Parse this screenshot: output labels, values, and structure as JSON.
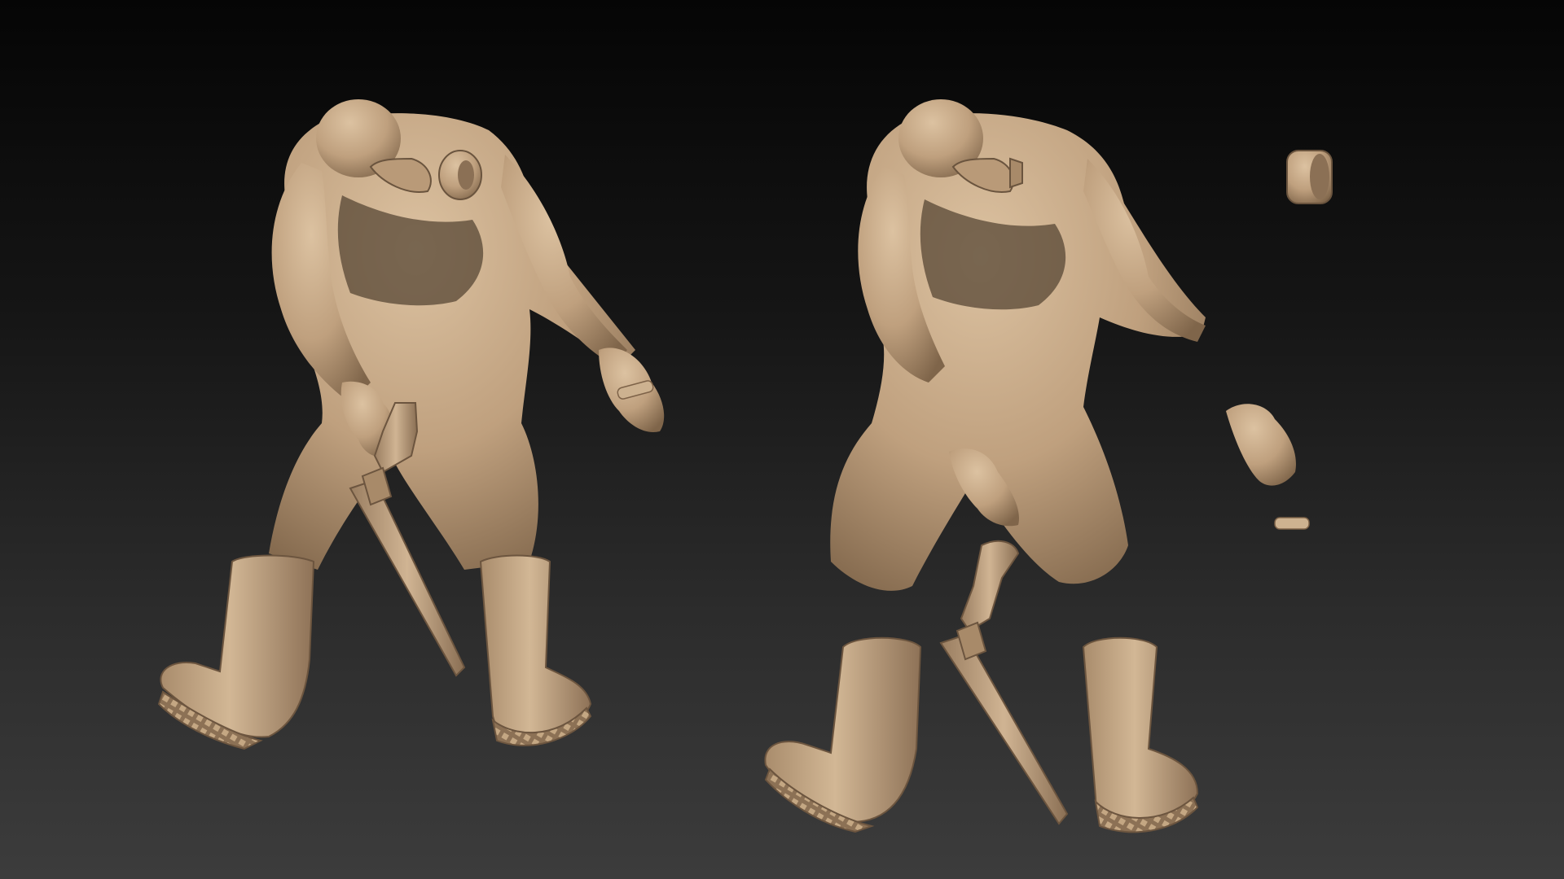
{
  "scene": {
    "background": {
      "top": "#050505",
      "bottom": "#3c3c3c"
    },
    "clay": {
      "base": "#c2a482",
      "light": "#d8bd9c",
      "shade": "#8a6f52",
      "dark": "#5e4a36"
    },
    "models": [
      {
        "name": "assembled-figure",
        "parts": [
          "body",
          "head",
          "gas-mask",
          "left-glove",
          "right-glove",
          "shotgun",
          "left-boot",
          "right-boot",
          "cartridge"
        ]
      },
      {
        "name": "exploded-figure",
        "parts": [
          "body",
          "head",
          "gas-mask",
          "filter-canister",
          "left-glove",
          "right-glove",
          "shotgun",
          "left-boot",
          "right-boot",
          "cartridge"
        ]
      }
    ]
  }
}
